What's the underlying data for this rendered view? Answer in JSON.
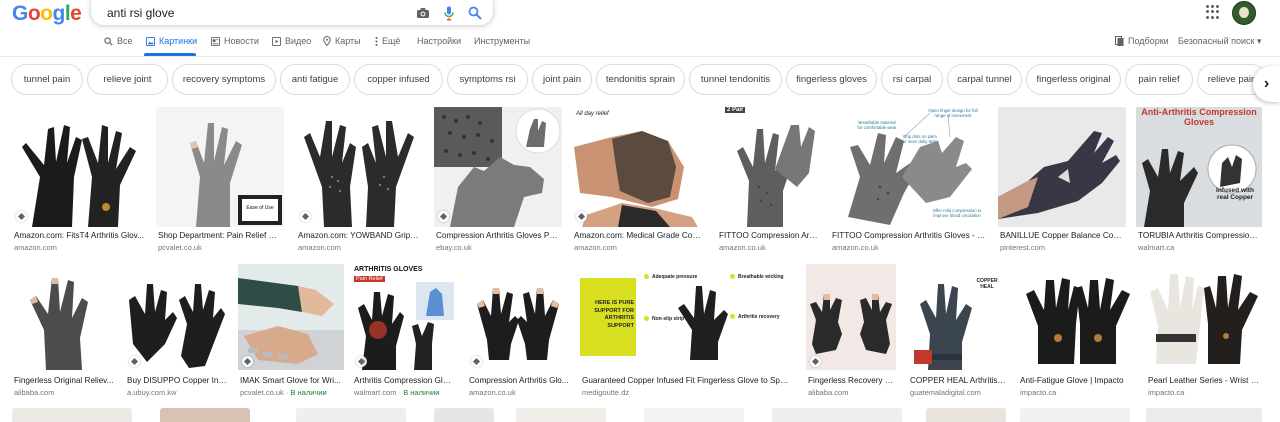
{
  "header": {
    "logo": "Google",
    "search_value": "anti rsi glove"
  },
  "tabs": [
    {
      "label": "Все",
      "icon": "search-icon"
    },
    {
      "label": "Картинки",
      "icon": "image-icon",
      "active": true
    },
    {
      "label": "Новости",
      "icon": "news-icon"
    },
    {
      "label": "Видео",
      "icon": "video-icon"
    },
    {
      "label": "Карты",
      "icon": "location-icon"
    },
    {
      "label": "Ещё",
      "icon": "more-icon"
    },
    {
      "label": "Настройки"
    },
    {
      "label": "Инструменты"
    }
  ],
  "right_tools": {
    "saved": "Подборки",
    "safesearch": "Безопасный поиск ▾"
  },
  "chips": [
    "tunnel pain",
    "relieve joint",
    "recovery symptoms",
    "anti fatigue",
    "copper infused",
    "symptoms rsi",
    "joint pain",
    "tendonitis sprain",
    "tunnel tendonitis",
    "fingerless gloves",
    "rsi carpal",
    "carpal tunnel",
    "fingerless original",
    "pain relief",
    "relieve pain"
  ],
  "results": [
    {
      "caption": "Amazon.com: FitsT4 Arthritis Glov...",
      "source": "amazon.com"
    },
    {
      "caption": "Shop Department: Pain Relief Sup...",
      "source": "pcvalet.co.uk"
    },
    {
      "caption": "Amazon.com: YOWBAND Grippy ...",
      "source": "amazon.com"
    },
    {
      "caption": "Compression Arthritis Gloves Pai...",
      "source": "ebay.co.uk"
    },
    {
      "caption": "Amazon.com: Medical Grade Copp...",
      "source": "amazon.com"
    },
    {
      "caption": "FITTOO Compression Arth...",
      "source": "amazon.co.uk"
    },
    {
      "caption": "FITTOO Compression Arthritis Gloves - He...",
      "source": "amazon.co.uk"
    },
    {
      "caption": "BANILLUE Copper Balance Comp...",
      "source": "pinterest.com"
    },
    {
      "caption": "TORUBIA Arthritis Compression ...",
      "source": "walmart.ca"
    },
    {
      "caption": "Fingerless Original Reliev...",
      "source": "alibaba.com"
    },
    {
      "caption": "Buy DISUPPO Copper Infu...",
      "source": "a.ubuy.com.kw"
    },
    {
      "caption": "IMAK Smart Glove for Wri...",
      "source": "pcvalet.co.uk",
      "stock": "В наличии"
    },
    {
      "caption": "Arthritis Compression Glo...",
      "source": "walmart.com",
      "stock": "В наличии"
    },
    {
      "caption": "Compression Arthritis Glo...",
      "source": "amazon.co.uk"
    },
    {
      "caption": "Guaranteed Copper Infused Fit Fingerless Glove to Speed ...",
      "source": "medigoutte.dz"
    },
    {
      "caption": "Fingerless Recovery Sy...",
      "source": "alibaba.com"
    },
    {
      "caption": "COPPER HEAL Arthritis ...",
      "source": "guatemaladigital.com"
    },
    {
      "caption": "Anti-Fatigue Glove | Impacto",
      "source": "impacto.ca"
    },
    {
      "caption": "Pearl Leather Series - Wrist | I...",
      "source": "impacto.ca"
    }
  ],
  "image_text": {
    "r1_2": "Ease of Use",
    "r1_5": "All day relief",
    "r1_6": "2 Pair",
    "r1_7a": "Breathable material for comfortable wear",
    "r1_7b": "Open finger design for full range of movement",
    "r1_7c": "Grip dots on palm for more daily tasks",
    "r1_7d": "Offer mild compression to improve blood circulation",
    "r1_9a": "Anti-Arthritis Compression Gloves",
    "r1_9b": "Infused with real Copper",
    "r2_4": "ARTHRITIS GLOVES",
    "r2_4b": "Pain Relief",
    "r2_6a": "HERE IS PURE SUPPORT FOR ARTHRITIS SUPPORT",
    "r2_6b": "Adequate pressure",
    "r2_6c": "Breathable wicking",
    "r2_6d": "Non-slip strip",
    "r2_6e": "Arthritis recovery",
    "r2_8": "COPPER HEAL"
  },
  "colors": {
    "accent": "#1a73e8",
    "green": "#188038"
  }
}
